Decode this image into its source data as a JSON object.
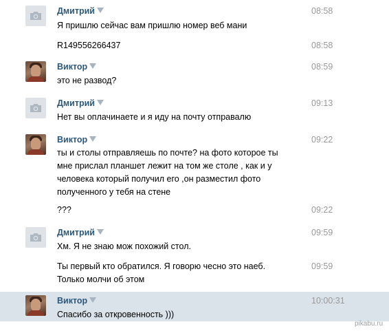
{
  "messages": [
    {
      "sender": "Дмитрий",
      "avatar": "camera-placeholder",
      "time": "08:58",
      "text": "Я пришлю сейчас вам пришлю номер веб мани"
    },
    {
      "time": "08:58",
      "text": "R149556266437"
    },
    {
      "sender": "Виктор",
      "avatar": "photo",
      "time": "08:59",
      "text": "это не развод?"
    },
    {
      "sender": "Дмитрий",
      "avatar": "camera-placeholder",
      "time": "09:13",
      "text": "Нет вы оплачинаете и я иду на почту отправалю"
    },
    {
      "sender": "Виктор",
      "avatar": "photo",
      "time": "09:22",
      "lines": [
        "ты и столы отправляешь по почте? на фото которое ты",
        "мне прислал планшет лежит на том же столе , как и у",
        "человека который получил его ,он разместил фото",
        "полученного у тебя на стене"
      ]
    },
    {
      "time": "09:22",
      "text": "???"
    },
    {
      "sender": "Дмитрий",
      "avatar": "camera-placeholder",
      "time": "09:59",
      "text": "Хм. Я не знаю мож похожий стол."
    },
    {
      "time": "09:59",
      "lines": [
        "Ты первый кто обратился. Я говорю чесно это наеб.",
        "Только молчи об этом"
      ]
    },
    {
      "sender": "Виктор",
      "avatar": "photo",
      "time": "10:00:31",
      "text": "Спасибо за откровенность )))",
      "highlighted": true
    }
  ],
  "watermark": "pikabu.ru",
  "colors": {
    "name": "#2b587a",
    "time": "#999999",
    "highlight": "#dae2ea",
    "avatar_placeholder": "#dfe3e8"
  }
}
